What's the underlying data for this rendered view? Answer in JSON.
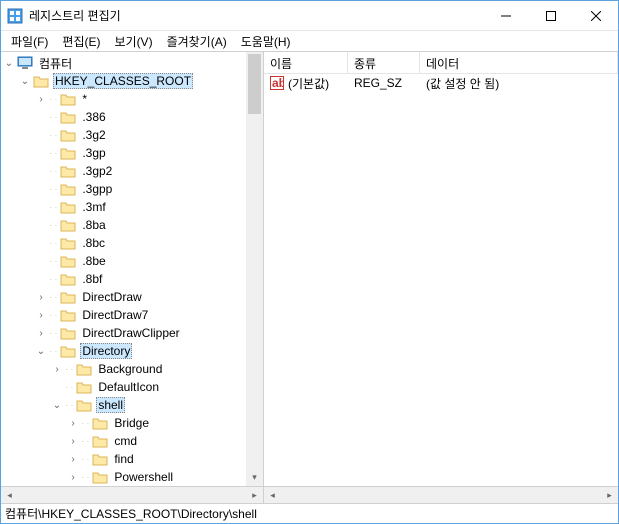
{
  "title": "레지스트리 편집기",
  "menu": {
    "file": "파일(F)",
    "edit": "편집(E)",
    "view": "보기(V)",
    "favorites": "즐겨찾기(A)",
    "help": "도움말(H)"
  },
  "tree": {
    "root": "컴퓨터",
    "hkcr": "HKEY_CLASSES_ROOT",
    "items": {
      "star": "*",
      "ext_386": ".386",
      "ext_3g2": ".3g2",
      "ext_3gp": ".3gp",
      "ext_3gp2": ".3gp2",
      "ext_3gpp": ".3gpp",
      "ext_3mf": ".3mf",
      "ext_8ba": ".8ba",
      "ext_8bc": ".8bc",
      "ext_8be": ".8be",
      "ext_8bf": ".8bf",
      "directdraw": "DirectDraw",
      "directdraw7": "DirectDraw7",
      "directdrawclipper": "DirectDrawClipper",
      "directory": "Directory",
      "background": "Background",
      "defaulticon": "DefaultIcon",
      "shell": "shell",
      "bridge": "Bridge",
      "cmd": "cmd",
      "find": "find",
      "powershell": "Powershell"
    }
  },
  "list": {
    "columns": {
      "name": "이름",
      "type": "종류",
      "data": "데이터"
    },
    "rows": [
      {
        "name": "(기본값)",
        "type": "REG_SZ",
        "data": "(값 설정 안 됨)"
      }
    ]
  },
  "statusbar": "컴퓨터\\HKEY_CLASSES_ROOT\\Directory\\shell"
}
